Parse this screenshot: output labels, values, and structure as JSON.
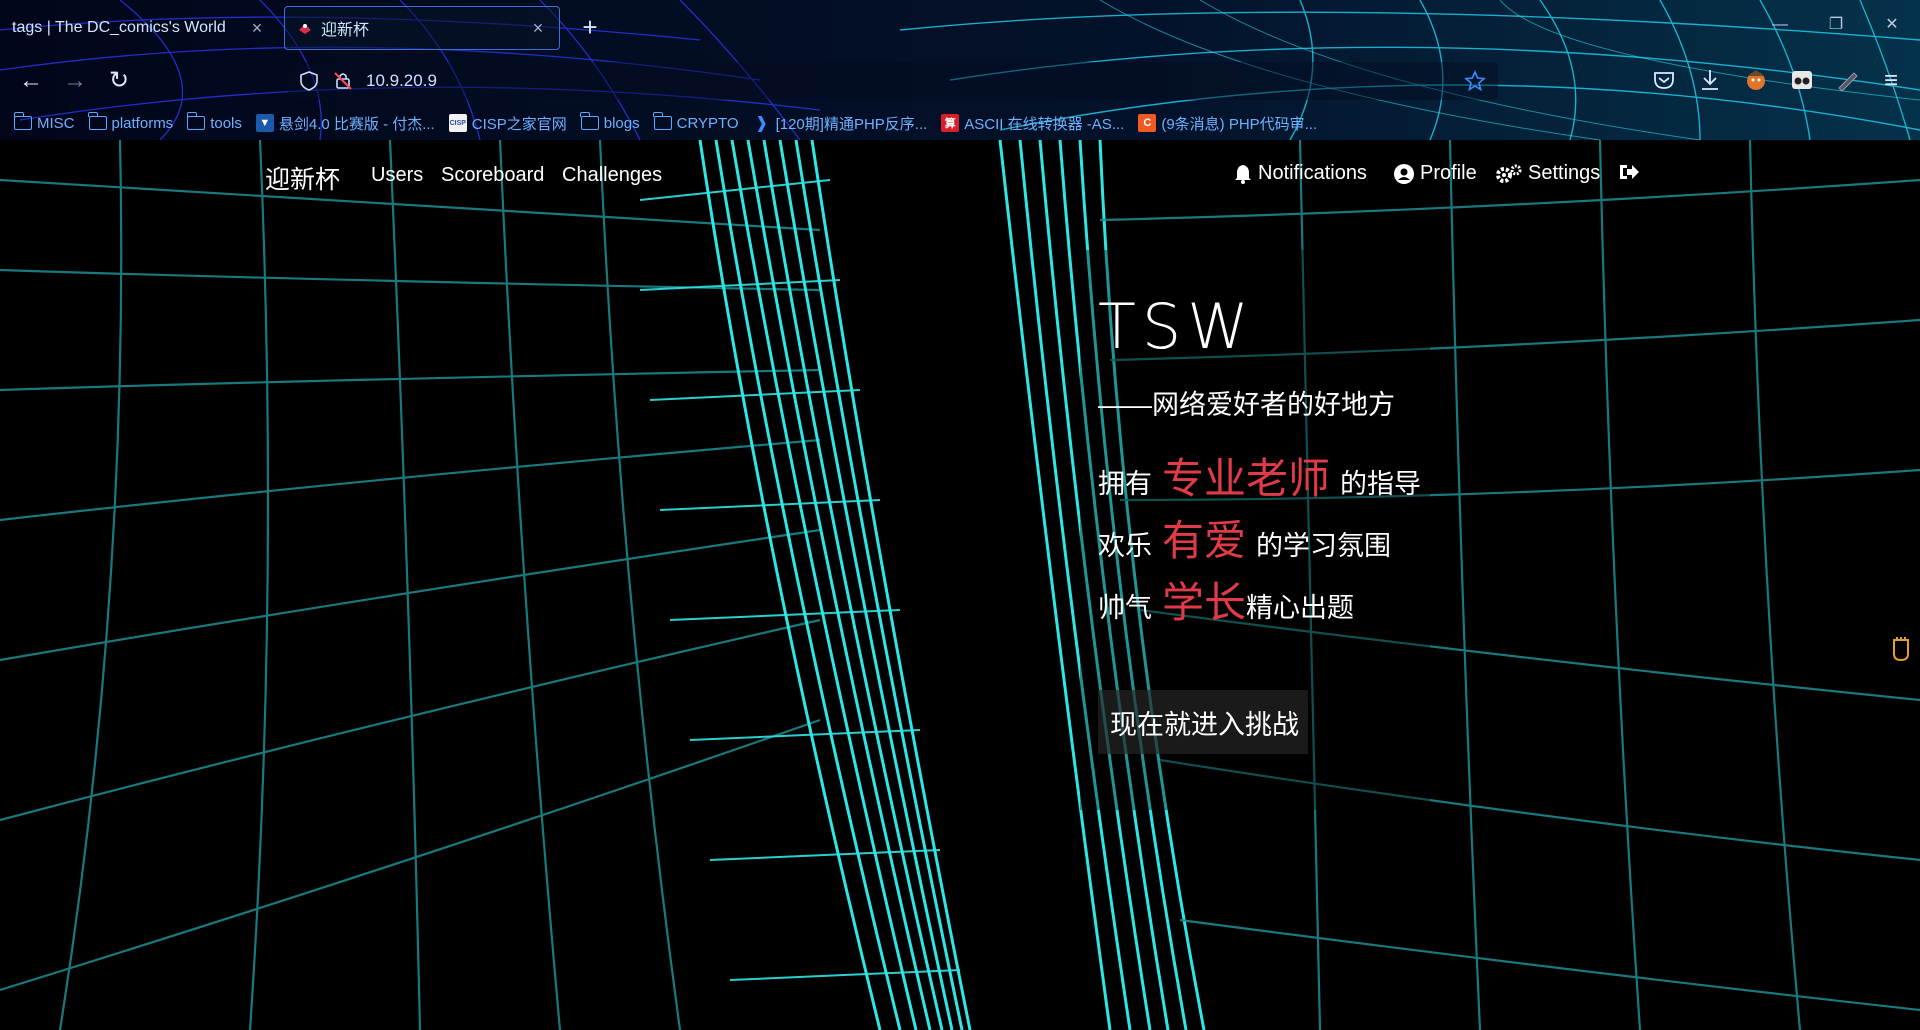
{
  "browser": {
    "tabs": [
      {
        "title": "tags | The DC_comics's World",
        "active": false
      },
      {
        "title": "迎新杯",
        "active": true
      }
    ],
    "new_tab": "+",
    "url": "10.9.20.9",
    "window_controls": {
      "minimize": "—",
      "restore": "❐",
      "close": "✕"
    },
    "bookmarks": [
      {
        "label": "MISC",
        "icon": "folder-icon"
      },
      {
        "label": "platforms",
        "icon": "folder-icon"
      },
      {
        "label": "tools",
        "icon": "folder-icon"
      },
      {
        "label": "悬剑4.0 比赛版 - 付杰...",
        "icon": "shield-favicon"
      },
      {
        "label": "CISP之家官网",
        "icon": "cisp-favicon"
      },
      {
        "label": "blogs",
        "icon": "folder-icon"
      },
      {
        "label": "CRYPTO",
        "icon": "folder-icon"
      },
      {
        "label": "[120期]精通PHP反序...",
        "icon": "bilibili-favicon"
      },
      {
        "label": "ASCII 在线转换器 -AS...",
        "icon": "suan-favicon",
        "badge": "算"
      },
      {
        "label": "(9条消息) PHP代码审...",
        "icon": "csdn-favicon",
        "badge": "C"
      }
    ]
  },
  "site": {
    "brand": "迎新杯",
    "nav_left": [
      "Users",
      "Scoreboard",
      "Challenges"
    ],
    "nav_right": {
      "notifications": "Notifications",
      "profile": "Profile",
      "settings": "Settings"
    }
  },
  "hero": {
    "title": "TSW",
    "subtitle": "——网络爱好者的好地方",
    "line1": {
      "pre": "拥有",
      "highlight": "专业老师",
      "post": "的指导"
    },
    "line2": {
      "pre": "欢乐",
      "highlight": "有爱",
      "post": "的学习氛围"
    },
    "line3": {
      "pre": "帅气",
      "highlight": "学长",
      "post": "精心出题"
    },
    "cta": "现在就进入挑战"
  },
  "colors": {
    "accent_red": "#e23a48",
    "grid_cyan": "#2ee6e6",
    "link_blue": "#6fb0ff"
  }
}
